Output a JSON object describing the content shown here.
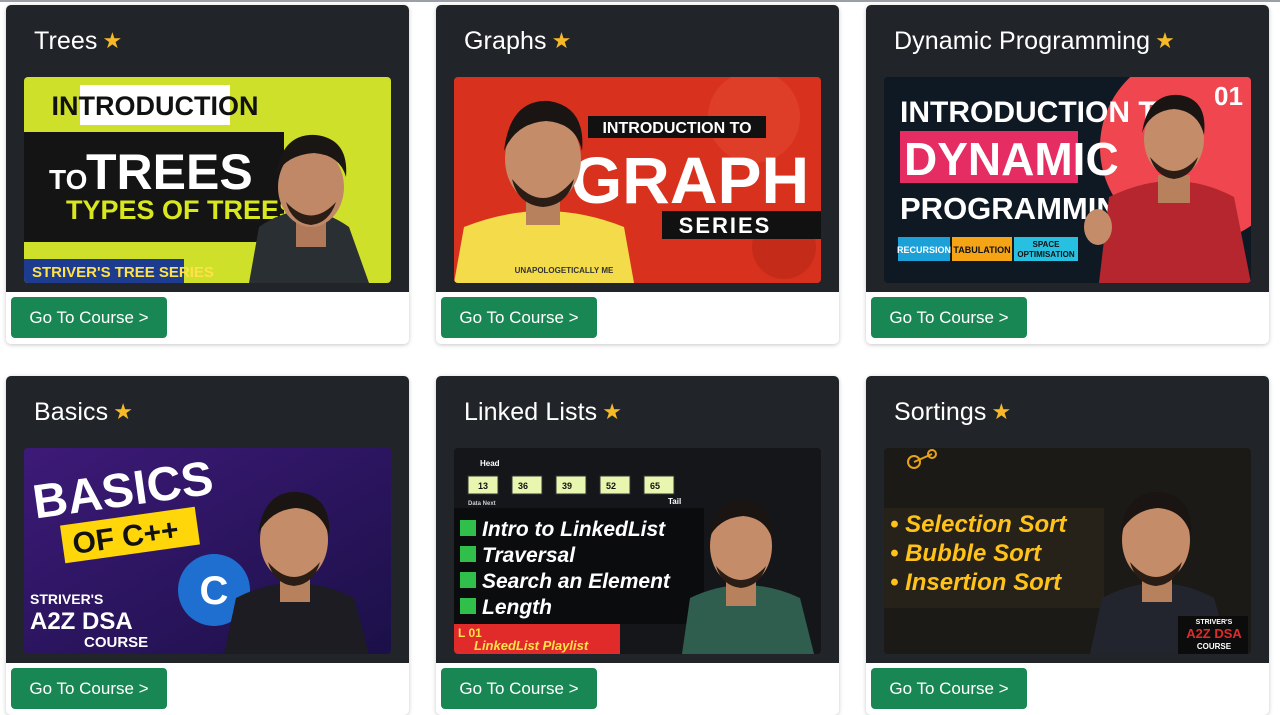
{
  "cards": [
    {
      "title": "Trees",
      "button": "Go To Course >",
      "thumb": {
        "line1": "INTRODUCTION",
        "line2a": "TO",
        "line2b": "TREES",
        "line3": "TYPES OF TREES",
        "ribbon": "STRIVER'S TREE SERIES"
      }
    },
    {
      "title": "Graphs",
      "button": "Go To Course >",
      "thumb": {
        "line1": "INTRODUCTION TO",
        "line2": "GRAPH",
        "line3": "SERIES",
        "shirt": "UNAPOLOGETICALLY ME"
      }
    },
    {
      "title": "Dynamic Programming",
      "button": "Go To Course >",
      "thumb": {
        "line1": "INTRODUCTION TO",
        "line2": "DYNAMIC",
        "line3": "PROGRAMMING",
        "episode": "01",
        "tags": [
          "RECURSION",
          "TABULATION",
          "SPACE",
          "OPTIMISATION"
        ]
      }
    },
    {
      "title": "Basics",
      "button": "Go To Course >",
      "thumb": {
        "line1": "BASICS",
        "line2": "OF C++",
        "brand1": "STRIVER'S",
        "brand2": "A2Z DSA",
        "brand3": "COURSE"
      }
    },
    {
      "title": "Linked Lists",
      "button": "Go To Course >",
      "thumb": {
        "head": "Head",
        "tail": "Tail",
        "nodes": [
          "13",
          "36",
          "39",
          "52",
          "65"
        ],
        "node_caption": "Data Next",
        "items": [
          "Intro to LinkedList",
          "Traversal",
          "Search an Element",
          "Length"
        ],
        "lecture": "L 01",
        "playlist": "LinkedList Playlist"
      }
    },
    {
      "title": "Sortings",
      "button": "Go To Course >",
      "thumb": {
        "items": [
          "• Selection Sort",
          "• Bubble Sort",
          "• Insertion Sort"
        ],
        "brand1": "STRIVER'S",
        "brand2": "A2Z DSA",
        "brand3": "COURSE"
      }
    }
  ],
  "icons": {
    "star": "star-icon"
  },
  "colors": {
    "card_header": "#212529",
    "button": "#198754",
    "star": "#f7b928"
  }
}
